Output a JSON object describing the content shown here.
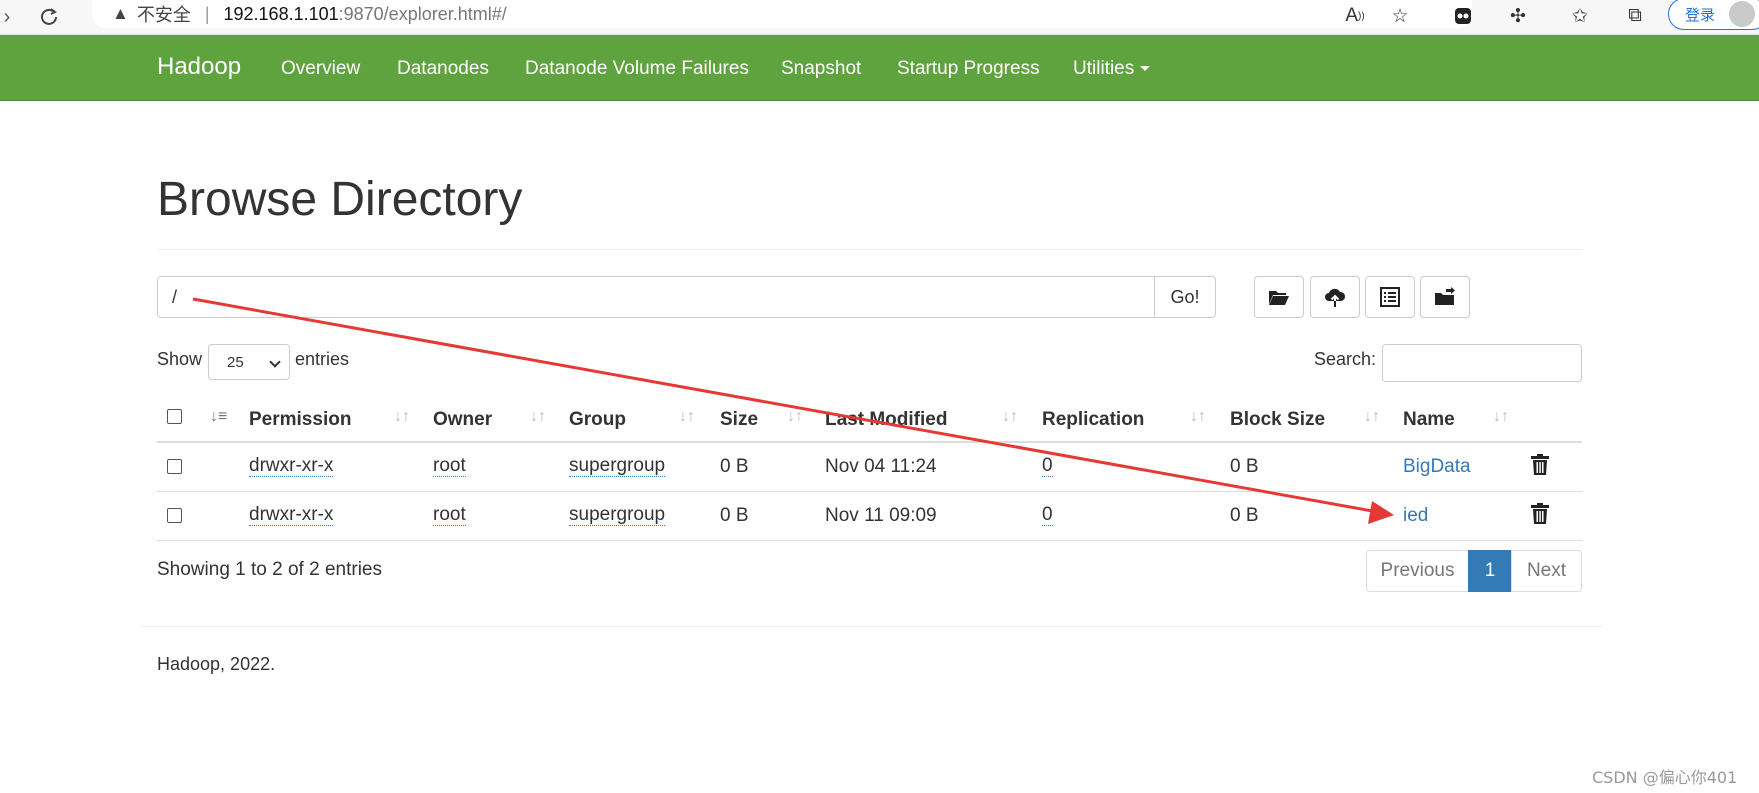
{
  "browser": {
    "security_label": "不安全",
    "separator": "|",
    "url_host": "192.168.1.101",
    "url_path": ":9870/explorer.html#/",
    "login_label": "登录"
  },
  "navbar": {
    "brand": "Hadoop",
    "items": [
      "Overview",
      "Datanodes",
      "Datanode Volume Failures",
      "Snapshot",
      "Startup Progress",
      "Utilities"
    ]
  },
  "page": {
    "title": "Browse Directory",
    "path_value": "/",
    "go_label": "Go!",
    "show_label": "Show",
    "entries_value": "25",
    "entries_label": "entries",
    "search_label": "Search:"
  },
  "table": {
    "headers": [
      "Permission",
      "Owner",
      "Group",
      "Size",
      "Last Modified",
      "Replication",
      "Block Size",
      "Name"
    ],
    "rows": [
      {
        "permission": "drwxr-xr-x",
        "owner": "root",
        "group": "supergroup",
        "size": "0 B",
        "modified": "Nov 04 11:24",
        "replication": "0",
        "block_size": "0 B",
        "name": "BigData"
      },
      {
        "permission": "drwxr-xr-x",
        "owner": "root",
        "group": "supergroup",
        "size": "0 B",
        "modified": "Nov 11 09:09",
        "replication": "0",
        "block_size": "0 B",
        "name": "ied"
      }
    ],
    "info": "Showing 1 to 2 of 2 entries",
    "pagination": {
      "previous": "Previous",
      "current": "1",
      "next": "Next"
    }
  },
  "footer": {
    "text": "Hadoop, 2022."
  },
  "watermark": "CSDN @偏心你401",
  "colors": {
    "navbar_bg": "#5fa33e",
    "link": "#337ab7",
    "annotation_arrow": "#e53935"
  }
}
